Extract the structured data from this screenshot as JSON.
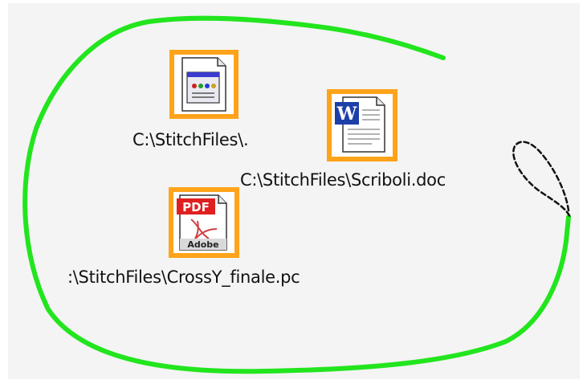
{
  "files": [
    {
      "label": "C:\\StitchFiles\\.",
      "icon": "html-file-icon"
    },
    {
      "label": "C:\\StitchFiles\\Scriboli.doc",
      "icon": "word-doc-icon"
    },
    {
      "label": ":\\StitchFiles\\CrossY_finale.pc",
      "icon": "pdf-file-icon",
      "icon_text": [
        "PDF",
        "Adobe"
      ]
    }
  ],
  "colors": {
    "highlight_frame": "#ffa31a",
    "lasso_stroke": "#22e51e",
    "dashed_stroke": "#111111",
    "background": "#f4f4f4"
  }
}
